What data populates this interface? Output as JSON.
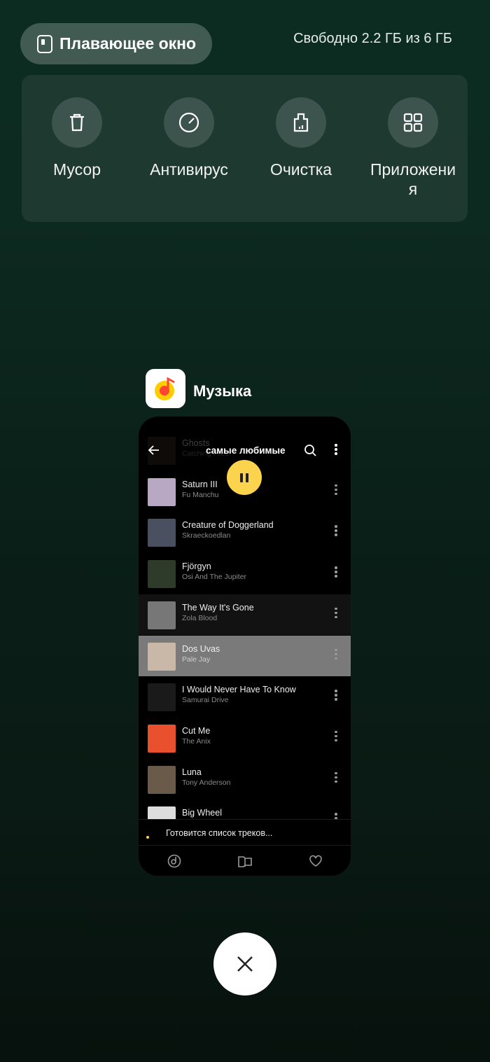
{
  "floating_window": {
    "label": "Плавающее окно",
    "icon": "floating-window-icon"
  },
  "memory": "Свободно 2.2 ГБ из 6 ГБ",
  "tools": [
    {
      "label": "Мусор",
      "icon": "trash-icon"
    },
    {
      "label": "Антивирус",
      "icon": "antivirus-icon"
    },
    {
      "label": "Очистка",
      "icon": "cleanup-icon"
    },
    {
      "label": "Приложени я",
      "icon": "apps-grid-icon"
    }
  ],
  "app": {
    "title": "Музыка",
    "icon": "yandex-music-icon"
  },
  "music": {
    "header_title": "самые любимые",
    "status": "Готовится список треков...",
    "tracks": [
      {
        "title": "Ghosts",
        "artist": "Catching Flies",
        "thumb": "#3a2a22"
      },
      {
        "title": "Saturn III",
        "artist": "Fu Manchu",
        "thumb": "#b9a8c4"
      },
      {
        "title": "Creature of Doggerland",
        "artist": "Skraeckoedlan",
        "thumb": "#4a5060"
      },
      {
        "title": "Fjörgyn",
        "artist": "Osi And The Jupiter",
        "thumb": "#2e3a2a"
      },
      {
        "title": "The Way It's Gone",
        "artist": "Zola Blood",
        "thumb": "#777777"
      },
      {
        "title": "Dos Uvas",
        "artist": "Pale Jay",
        "thumb": "#c9b8a8"
      },
      {
        "title": "I Would Never Have To Know",
        "artist": "Samurai Drive",
        "thumb": "#1a1a1a"
      },
      {
        "title": "Cut Me",
        "artist": "The Anix",
        "thumb": "#e8502e"
      },
      {
        "title": "Luna",
        "artist": "Tony Anderson",
        "thumb": "#6a5a4a"
      },
      {
        "title": "Big Wheel",
        "artist": "",
        "thumb": "#dddddd"
      }
    ],
    "colors": {
      "accent": "#fcd34d",
      "highlight_row": "#7a7a7a",
      "playing_row": "#121212"
    }
  }
}
